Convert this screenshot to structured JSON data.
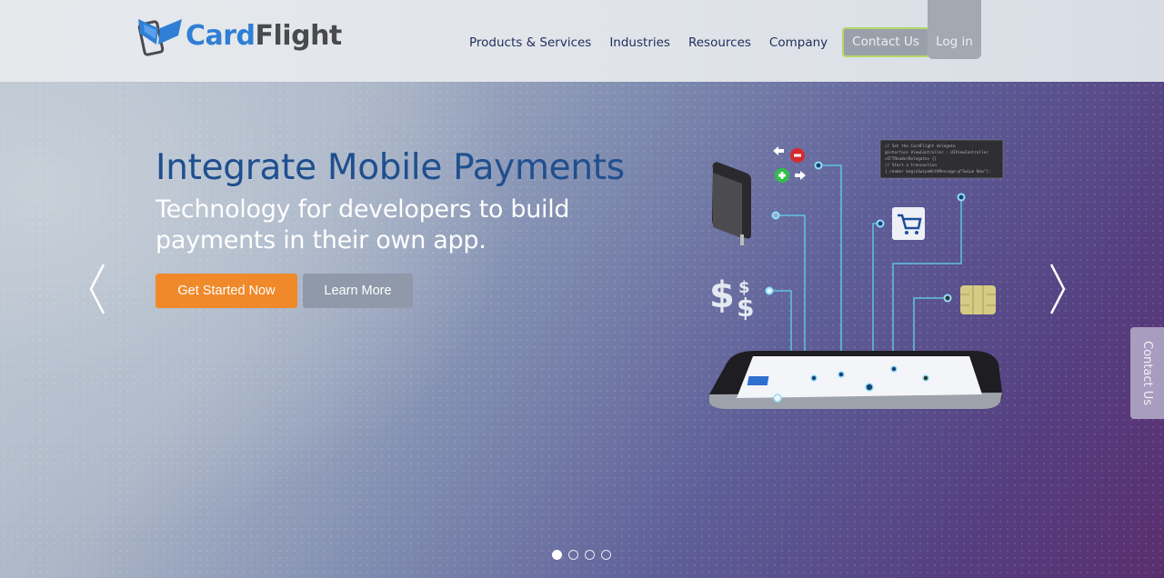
{
  "header": {
    "logo": {
      "part1": "Card",
      "part2": "Flight",
      "icon": "cardflight-wing-phone-icon"
    },
    "nav": [
      {
        "label": "Products & Services"
      },
      {
        "label": "Industries"
      },
      {
        "label": "Resources"
      },
      {
        "label": "Company"
      }
    ],
    "contact_label": "Contact Us",
    "login_label": "Log in"
  },
  "hero": {
    "headline": "Integrate Mobile Payments",
    "subhead": "Technology for developers to build payments in their own app.",
    "primary_button": "Get Started Now",
    "secondary_button": "Learn More",
    "prev_icon": "chevron-left-icon",
    "next_icon": "chevron-right-icon",
    "slides": {
      "count": 4,
      "active": 1
    },
    "illustration": {
      "code_snippet": [
        "// Set the CardFlight delegate",
        "@interface ViewController : UIViewController",
        "<CFTReaderDelegate> {}",
        "// Start a transaction",
        "[_reader beginSwipeWithMessage:@\"Swipe Now\"];"
      ]
    }
  },
  "side_tab": {
    "label": "Contact Us"
  },
  "colors": {
    "brand_blue": "#2f7fd6",
    "headline_blue": "#1f4f8f",
    "nav_text": "#1f2d5c",
    "primary_orange": "#f0892a",
    "contact_border": "#b6d86a",
    "connector_line": "#5fc3e4"
  }
}
